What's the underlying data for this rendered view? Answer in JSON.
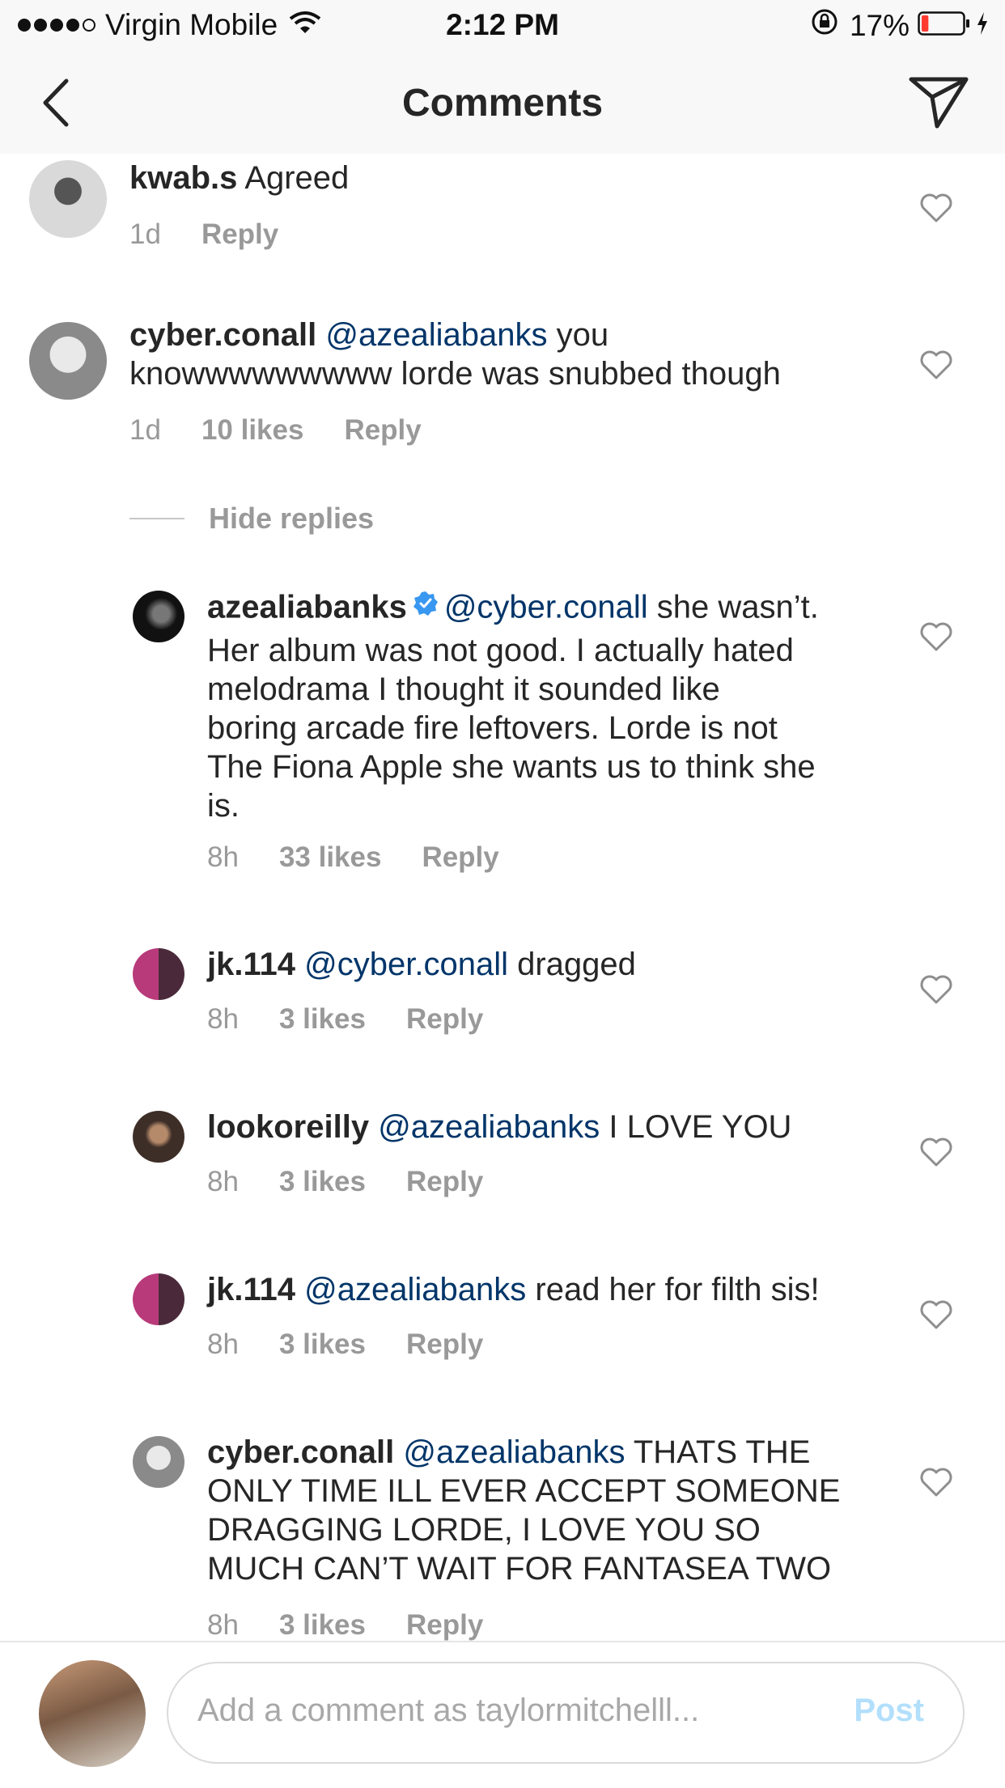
{
  "status_bar": {
    "carrier": "Virgin Mobile",
    "time": "2:12 PM",
    "battery": "17%",
    "battery_level": 0.17
  },
  "nav": {
    "title": "Comments",
    "back_icon": "chevron-left-icon",
    "share_icon": "paper-plane-icon"
  },
  "comments": [
    {
      "username": "kwab.s",
      "mention": "",
      "text": "Agreed",
      "time": "1d",
      "likes": "",
      "reply": "Reply"
    },
    {
      "username": "cyber.conall",
      "mention": "@azealiabanks",
      "text": "you",
      "text2": "knowwwwwwwww lorde was snubbed though",
      "time": "1d",
      "likes": "10 likes",
      "reply": "Reply"
    }
  ],
  "hide_replies": "Hide replies",
  "replies": [
    {
      "username": "azealiabanks",
      "verified": true,
      "mention": "@cyber.conall",
      "text_line1": "she wasn’t.",
      "text_lines": [
        "Her album was not good. I actually hated",
        "melodrama I thought it sounded like",
        "boring arcade fire leftovers. Lorde is not",
        "The Fiona Apple she wants us to think she",
        "is."
      ],
      "time": "8h",
      "likes": "33 likes",
      "reply": "Reply"
    },
    {
      "username": "jk.114",
      "mention": "@cyber.conall",
      "text": "dragged",
      "time": "8h",
      "likes": "3 likes",
      "reply": "Reply"
    },
    {
      "username": "lookoreilly",
      "mention": "@azealiabanks",
      "text": "I LOVE YOU",
      "time": "8h",
      "likes": "3 likes",
      "reply": "Reply"
    },
    {
      "username": "jk.114",
      "mention": "@azealiabanks",
      "text": "read her for filth sis!",
      "time": "8h",
      "likes": "3 likes",
      "reply": "Reply"
    },
    {
      "username": "cyber.conall",
      "mention": "@azealiabanks",
      "text": "THATS THE",
      "text_lines": [
        "ONLY TIME ILL EVER ACCEPT SOMEONE",
        "DRAGGING LORDE, I LOVE YOU SO",
        "MUCH CAN’T WAIT FOR FANTASEA TWO"
      ],
      "time": "8h",
      "likes": "3 likes",
      "reply": "Reply"
    }
  ],
  "composer": {
    "placeholder": "Add a comment as taylormitchelll...",
    "post_label": "Post"
  },
  "colors": {
    "mention": "#003569",
    "meta": "#999999",
    "post_disabled": "#b2dffc",
    "battery_low": "#ff3b30",
    "verified": "#3897f0"
  }
}
